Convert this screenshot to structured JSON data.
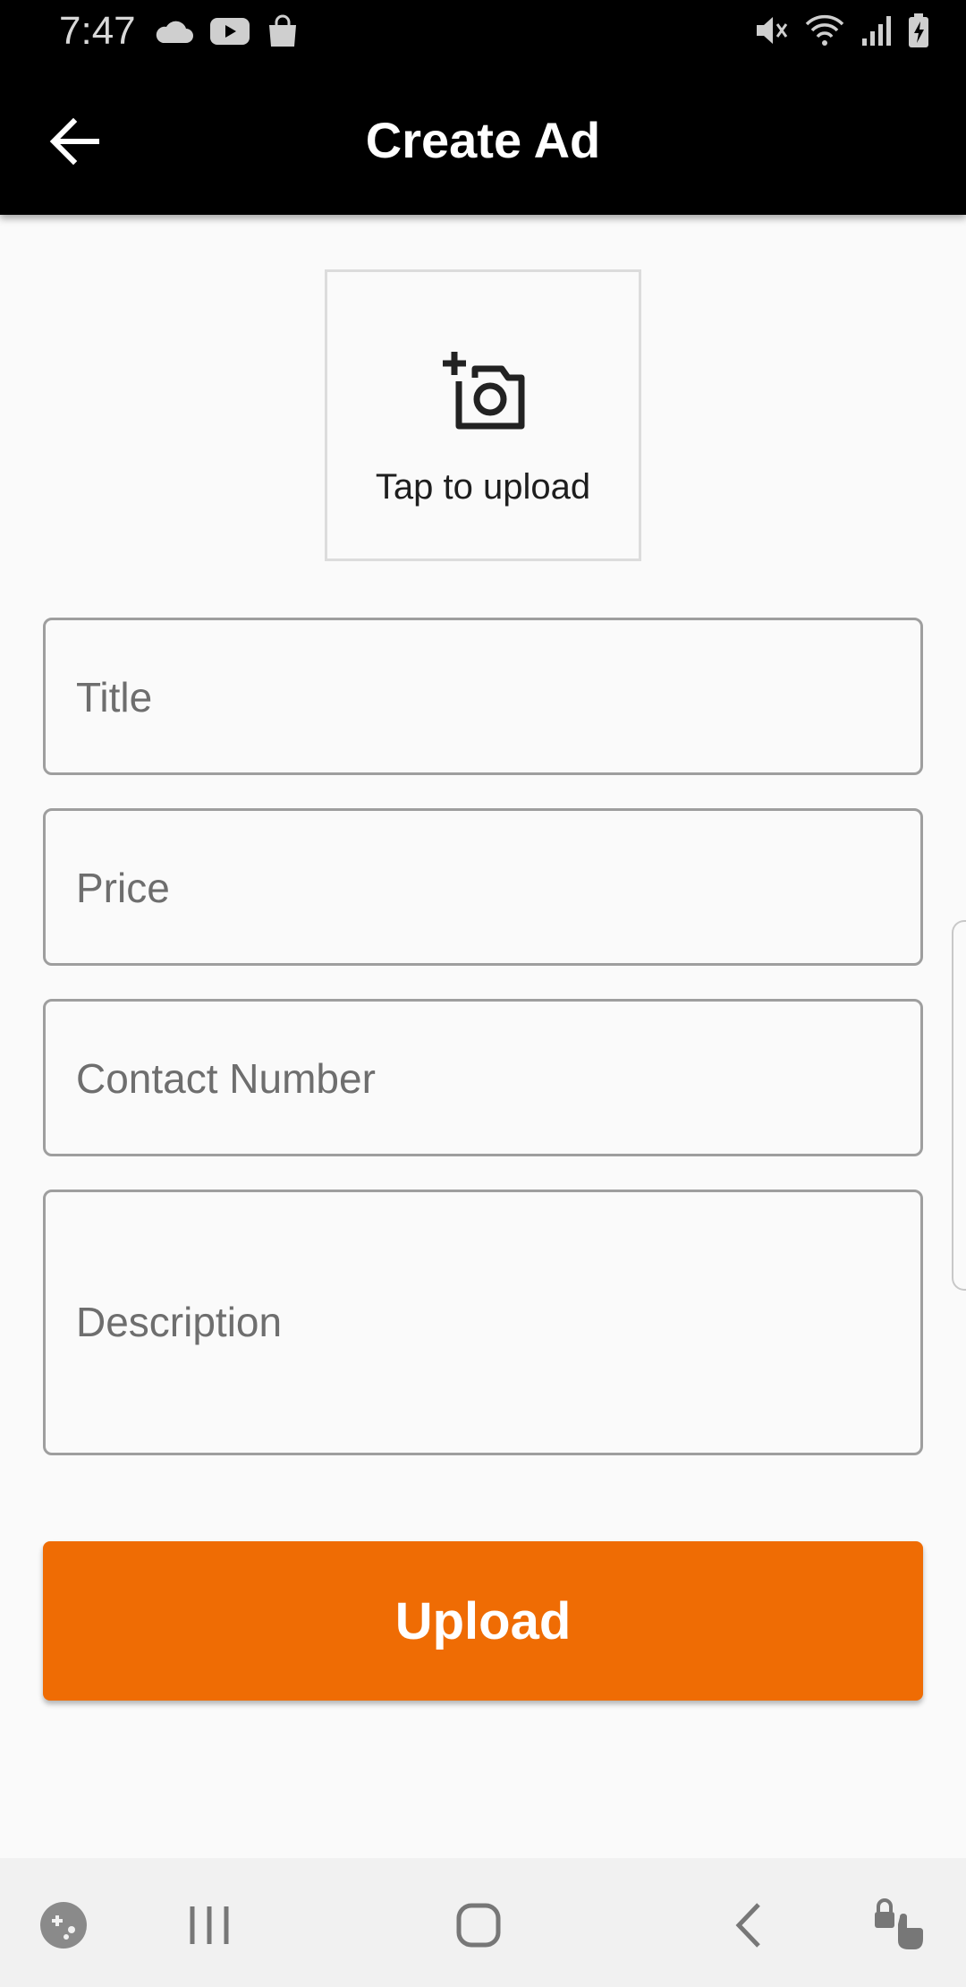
{
  "status_bar": {
    "time": "7:47",
    "left_icons": [
      "cloud-icon",
      "youtube-icon",
      "shopping-bag-icon"
    ],
    "right_icons": [
      "mute-icon",
      "wifi-icon",
      "signal-icon",
      "battery-charging-icon"
    ]
  },
  "app_bar": {
    "title": "Create Ad",
    "back_icon": "arrow-back-icon"
  },
  "image_upload": {
    "icon": "add-a-photo-icon",
    "label": "Tap to upload"
  },
  "form": {
    "title_placeholder": "Title",
    "title_value": "",
    "price_placeholder": "Price",
    "price_value": "",
    "contact_placeholder": "Contact Number",
    "contact_value": "",
    "description_placeholder": "Description",
    "description_value": ""
  },
  "upload_button": {
    "label": "Upload",
    "color": "#ef6c04"
  },
  "nav_bar": {
    "icons": [
      "game-launcher-icon",
      "recent-apps-icon",
      "home-icon",
      "back-icon",
      "lock-touch-icon"
    ]
  }
}
